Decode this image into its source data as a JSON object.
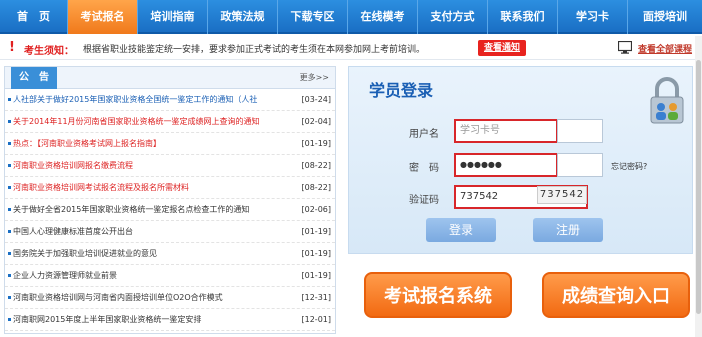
{
  "nav": {
    "items": [
      {
        "label": "首　页",
        "active": false
      },
      {
        "label": "考试报名",
        "active": true
      },
      {
        "label": "培训指南",
        "active": false
      },
      {
        "label": "政策法规",
        "active": false
      },
      {
        "label": "下载专区",
        "active": false
      },
      {
        "label": "在线模考",
        "active": false
      },
      {
        "label": "支付方式",
        "active": false
      },
      {
        "label": "联系我们",
        "active": false
      },
      {
        "label": "学习卡",
        "active": false
      },
      {
        "label": "面授培训",
        "active": false
      }
    ]
  },
  "notice": {
    "icon": "exclamation-icon",
    "title": "考生须知：",
    "text": "根据省职业技能鉴定统一安排，要求参加正式考试的考生须在本网参加网上考前培训。",
    "view_button": "查看通知",
    "all_courses_link": "查看全部课程"
  },
  "announcements": {
    "tab_label": "公　告",
    "more_label": "更多>>",
    "items": [
      {
        "title": "人社部关于做好2015年国家职业资格全国统一鉴定工作的通知（人社",
        "date": "[03-24]",
        "color": "blue",
        "date_color": "red"
      },
      {
        "title": "关于2014年11月份河南省国家职业资格统一鉴定成绩网上查询的通知",
        "date": "[02-04]",
        "color": "red",
        "date_color": "dark"
      },
      {
        "title": "热点：【河南职业资格考试网上报名指南】",
        "date": "[01-19]",
        "color": "red",
        "date_color": "dark"
      },
      {
        "title": "河南职业资格培训网报名缴费流程",
        "date": "[08-22]",
        "color": "red",
        "date_color": "dark"
      },
      {
        "title": "河南职业资格培训网考试报名流程及报名所需材料",
        "date": "[08-22]",
        "color": "red",
        "date_color": "dark"
      },
      {
        "title": "关于做好全省2015年国家职业资格统一鉴定报名点检查工作的通知",
        "date": "[02-06]",
        "color": "dark",
        "date_color": "dark"
      },
      {
        "title": "中国人心理健康标准首度公开出台",
        "date": "[01-19]",
        "color": "dark",
        "date_color": "dark"
      },
      {
        "title": "国务院关于加强职业培训促进就业的意见",
        "date": "[01-19]",
        "color": "dark",
        "date_color": "dark"
      },
      {
        "title": "企业人力资源管理师就业前景",
        "date": "[01-19]",
        "color": "dark",
        "date_color": "dark"
      },
      {
        "title": "河南职业资格培训网与河南省内面授培训单位O2O合作模式",
        "date": "[12-31]",
        "color": "dark",
        "date_color": "dark"
      },
      {
        "title": "河南职网2015年度上半年国家职业资格统一鉴定安排",
        "date": "[12-01]",
        "color": "dark",
        "date_color": "dark"
      }
    ]
  },
  "login": {
    "title": "学员登录",
    "username_label": "用户名",
    "username_placeholder": "学习卡号",
    "password_label": "密　码",
    "password_value": "●●●●●●",
    "forgot_label": "忘记密码?",
    "captcha_label": "验证码",
    "captcha_value": "737542",
    "captcha_image_text": "737542",
    "login_button": "登录",
    "register_button": "注册"
  },
  "big_buttons": {
    "exam_signup": "考试报名系统",
    "score_query": "成绩查询入口"
  },
  "colors": {
    "nav_blue": "#1a6fc4",
    "nav_active_orange": "#f0791b",
    "alert_red": "#e02020",
    "link_blue": "#1a5fb4"
  }
}
